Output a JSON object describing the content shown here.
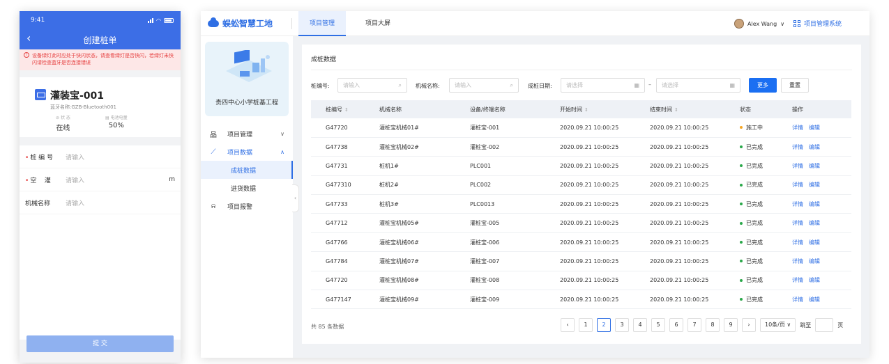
{
  "mobile": {
    "time": "9:41",
    "title": "创建桩单",
    "alert": "设备绿灯此时应处于快闪状态，请查看绿灯是否快闪，若绿灯未快闪请检查蓝牙是否连接错误",
    "device_name": "灌装宝-001",
    "device_sub": "蓝牙名称:GZB-Bluetooth001",
    "status_label": "状 态",
    "status_value": "在线",
    "battery_label": "电池电量",
    "battery_value": "50%",
    "fields": [
      {
        "label": "桩 编 号",
        "placeholder": "请输入",
        "required": true,
        "unit": ""
      },
      {
        "label": "空    灌",
        "placeholder": "请输入",
        "required": true,
        "unit": "m"
      },
      {
        "label": "机械名称",
        "placeholder": "请输入",
        "required": false,
        "unit": ""
      }
    ],
    "submit": "提 交"
  },
  "desktop": {
    "brand": "蜈蚣智慧工地",
    "tabs": [
      "项目管理",
      "项目大屏"
    ],
    "user": "Alex Wang",
    "system": "项目管理系统",
    "project_name": "贵四中心小学桩基工程",
    "menu": {
      "item1": "项目管理",
      "item2": "项目数据",
      "sub1": "成桩数据",
      "sub2": "进货数据",
      "item3": "项目报警"
    },
    "page_title": "成桩数据",
    "filters": {
      "pile_label": "桩编号:",
      "pile_ph": "请输入",
      "machine_label": "机械名称:",
      "machine_ph": "请输入",
      "date_label": "成桩日期:",
      "date_start_ph": "请选择",
      "date_sep": "–",
      "date_end_ph": "请选择",
      "more": "更多",
      "reset": "重置"
    },
    "table": {
      "headers": [
        "桩编号",
        "机械名称",
        "设备/终端名称",
        "开始时间",
        "结束时间",
        "状态",
        "操作"
      ],
      "actions": [
        "详情",
        "编辑"
      ],
      "rows": [
        [
          "G47720",
          "灌桩宝机械01#",
          "灌桩宝-001",
          "2020.09.21 10:00:25",
          "2020.09.21 10:00:25",
          "施工中"
        ],
        [
          "G47738",
          "灌桩宝机械02#",
          "灌桩宝-002",
          "2020.09.21 10:00:25",
          "2020.09.21 10:00:25",
          "已完成"
        ],
        [
          "G47731",
          "桩机1#",
          "PLC001",
          "2020.09.21 10:00:25",
          "2020.09.21 10:00:25",
          "已完成"
        ],
        [
          "G477310",
          "桩机2#",
          "PLC002",
          "2020.09.21 10:00:25",
          "2020.09.21 10:00:25",
          "已完成"
        ],
        [
          "G47733",
          "桩机3#",
          "PLC0013",
          "2020.09.21 10:00:25",
          "2020.09.21 10:00:25",
          "已完成"
        ],
        [
          "G47712",
          "灌桩宝机械05#",
          "灌桩宝-005",
          "2020.09.21 10:00:25",
          "2020.09.21 10:00:25",
          "已完成"
        ],
        [
          "G47766",
          "灌桩宝机械06#",
          "灌桩宝-006",
          "2020.09.21 10:00:25",
          "2020.09.21 10:00:25",
          "已完成"
        ],
        [
          "G47784",
          "灌桩宝机械07#",
          "灌桩宝-007",
          "2020.09.21 10:00:25",
          "2020.09.21 10:00:25",
          "已完成"
        ],
        [
          "G47720",
          "灌桩宝机械08#",
          "灌桩宝-008",
          "2020.09.21 10:00:25",
          "2020.09.21 10:00:25",
          "已完成"
        ],
        [
          "G477147",
          "灌桩宝机械09#",
          "灌桩宝-009",
          "2020.09.21 10:00:25",
          "2020.09.21 10:00:25",
          "已完成"
        ]
      ]
    },
    "total": "共 85 条数据",
    "pages": [
      "1",
      "2",
      "3",
      "4",
      "5",
      "6",
      "7",
      "8",
      "9"
    ],
    "current_page": "2",
    "page_size": "10条/页",
    "jump_label": "跳至",
    "page_unit": "页",
    "colors": {
      "accent": "#2f6fe4",
      "working": "#f5a623",
      "done": "#2aa84a"
    }
  }
}
